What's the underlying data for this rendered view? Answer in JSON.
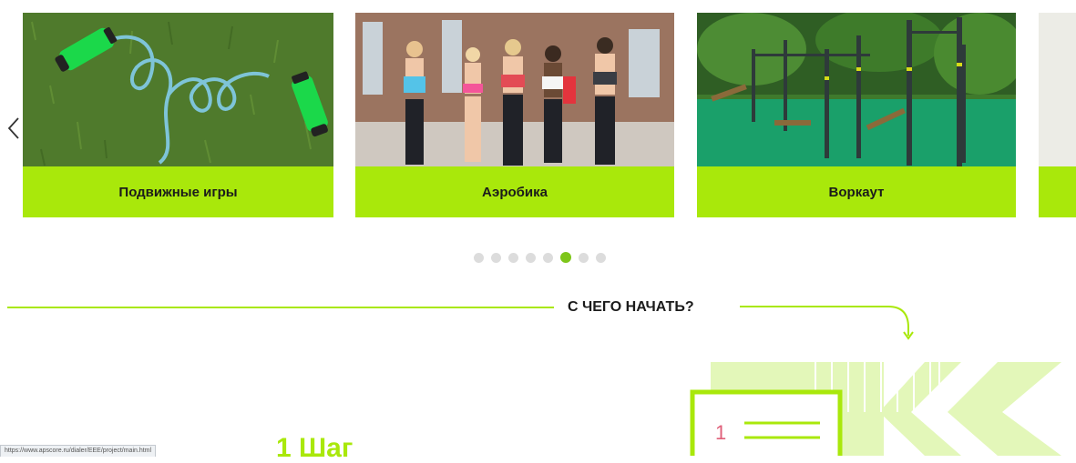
{
  "carousel": {
    "prev_arrow_icon": "chevron-left-icon",
    "cards": [
      {
        "label": "Подвижные игры"
      },
      {
        "label": "Аэробика"
      },
      {
        "label": "Воркаут"
      }
    ],
    "dots": {
      "count": 8,
      "active_index": 5
    }
  },
  "section": {
    "title": "С ЧЕГО НАЧАТЬ?"
  },
  "steps": {
    "first_heading": "1 Шаг",
    "first_number": "1"
  },
  "status_bar": {
    "url": "https://www.apscore.ru/dialer/EEE/project/main.html"
  },
  "colors": {
    "accent": "#a9e80b",
    "dot_active": "#7ec61a",
    "dot_inactive": "#dcdcdc"
  }
}
